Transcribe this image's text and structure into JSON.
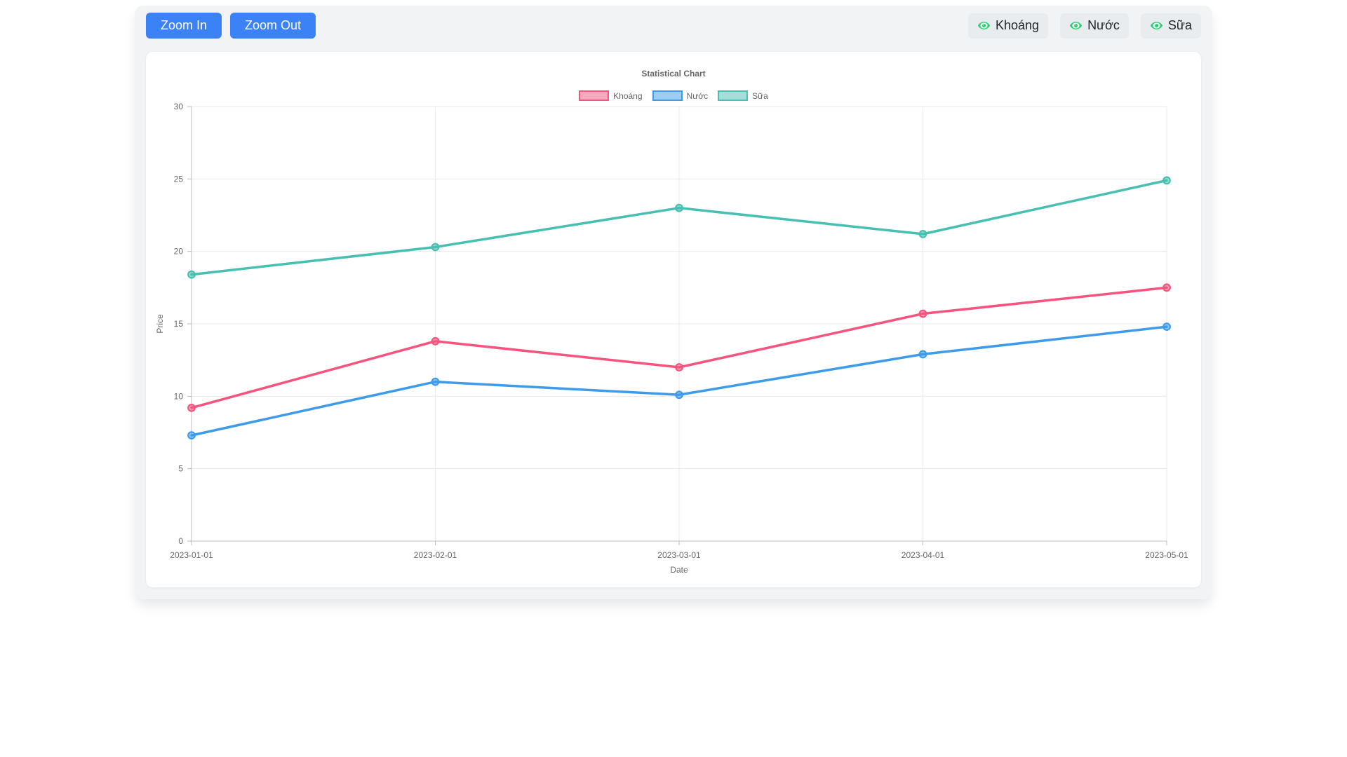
{
  "toolbar": {
    "zoom_in_label": "Zoom In",
    "zoom_out_label": "Zoom Out",
    "series_toggles": [
      {
        "key": "khoang",
        "label": "Khoáng",
        "icon": "eye-icon"
      },
      {
        "key": "nuoc",
        "label": "Nước",
        "icon": "eye-icon"
      },
      {
        "key": "sua",
        "label": "Sữa",
        "icon": "eye-icon"
      }
    ]
  },
  "colors": {
    "primary_button": "#3b82f6",
    "toggle_background": "#e9ecef",
    "eye_icon": "#2ecc71",
    "panel_background": "#f1f3f5",
    "grid": "#e9e9e9",
    "axis_border": "#bcbcbc",
    "tick_text": "#666666"
  },
  "chart_data": {
    "type": "line",
    "title": "Statistical Chart",
    "xlabel": "Date",
    "ylabel": "Price",
    "x": [
      "2023-01-01",
      "2023-02-01",
      "2023-03-01",
      "2023-04-01",
      "2023-05-01"
    ],
    "series": [
      {
        "name": "Khoáng",
        "color": "#f5547e",
        "values": [
          9.2,
          13.8,
          12.0,
          15.7,
          17.5
        ]
      },
      {
        "name": "Nước",
        "color": "#3d9bea",
        "values": [
          7.3,
          11.0,
          10.1,
          12.9,
          14.8
        ]
      },
      {
        "name": "Sữa",
        "color": "#47bfb1",
        "values": [
          18.4,
          20.3,
          23.0,
          21.2,
          24.9
        ]
      }
    ],
    "ylim": [
      0,
      30
    ],
    "yticks": [
      0,
      5,
      10,
      15,
      20,
      25,
      30
    ],
    "grid": true,
    "legend_position": "top"
  }
}
